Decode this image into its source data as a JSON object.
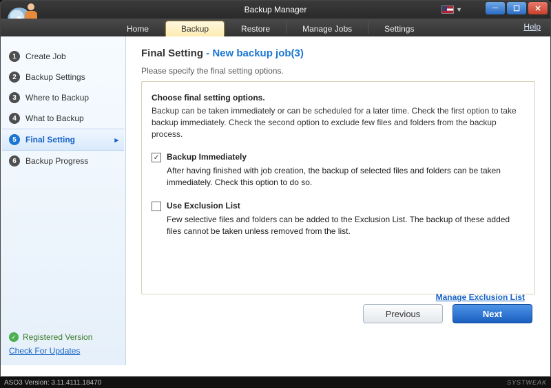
{
  "window": {
    "title": "Backup Manager"
  },
  "menutabs": [
    "Home",
    "Backup",
    "Restore",
    "Manage Jobs",
    "Settings"
  ],
  "active_tab_index": 1,
  "help_label": "Help",
  "sidebar": {
    "steps": [
      {
        "num": "1",
        "label": "Create Job"
      },
      {
        "num": "2",
        "label": "Backup Settings"
      },
      {
        "num": "3",
        "label": "Where to Backup"
      },
      {
        "num": "4",
        "label": "What to Backup"
      },
      {
        "num": "5",
        "label": "Final Setting"
      },
      {
        "num": "6",
        "label": "Backup Progress"
      }
    ],
    "active_step_index": 4,
    "registered": "Registered Version",
    "updates": "Check For Updates"
  },
  "page": {
    "heading_left": "Final Setting",
    "heading_sep": " - ",
    "heading_right": "New backup job(3)",
    "subline": "Please specify the final setting options.",
    "panel_title": "Choose final setting options.",
    "panel_desc": "Backup can be taken immediately or can be scheduled for a later time. Check the first option to take backup immediately. Check the second option to exclude few files and folders from the backup process.",
    "opt1": {
      "checked": true,
      "label": "Backup Immediately",
      "desc": "After having finished with job creation, the backup of selected files and folders can be taken immediately. Check this option to do so."
    },
    "opt2": {
      "checked": false,
      "label": "Use Exclusion List",
      "desc": "Few selective files and folders can be added to the Exclusion List. The backup of these added files cannot be taken unless removed from the list."
    },
    "manage_link": "Manage Exclusion List"
  },
  "buttons": {
    "previous": "Previous",
    "next": "Next"
  },
  "status": {
    "version": "ASO3 Version: 3.11.4111.18470",
    "brand": "SYSTWEAK"
  }
}
